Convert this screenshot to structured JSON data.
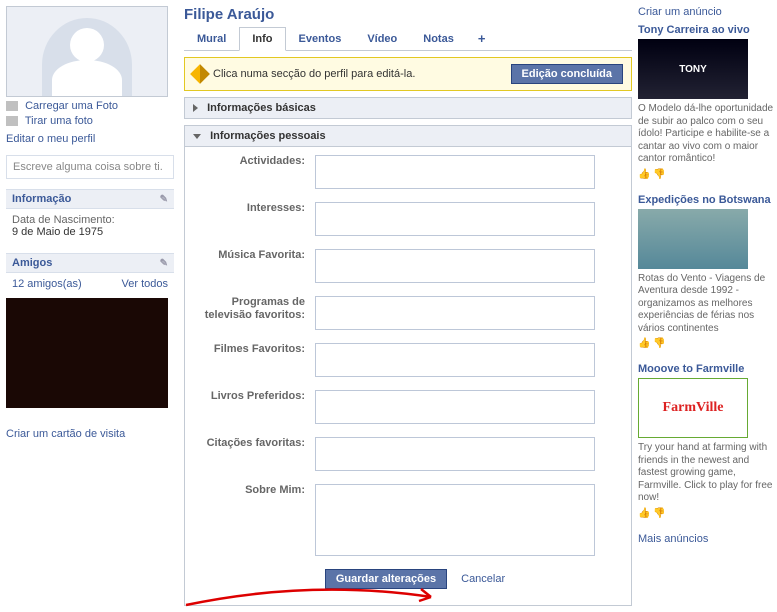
{
  "profile": {
    "name": "Filipe Araújo",
    "upload_photo": "Carregar uma Foto",
    "take_photo": "Tirar uma foto",
    "edit_profile": "Editar o meu perfil",
    "status_placeholder": "Escreve alguma coisa sobre ti."
  },
  "sidebar": {
    "info": {
      "title": "Informação",
      "dob_label": "Data de Nascimento:",
      "dob_value": "9 de Maio de 1975"
    },
    "friends": {
      "title": "Amigos",
      "count": "12 amigos(as)",
      "see_all": "Ver todos"
    },
    "biz_card": "Criar um cartão de visita"
  },
  "tabs": {
    "wall": "Mural",
    "info": "Info",
    "events": "Eventos",
    "video": "Vídeo",
    "notes": "Notas",
    "plus": "+"
  },
  "notice": {
    "text": "Clica numa secção do perfil para editá-la.",
    "done_btn": "Edição concluída"
  },
  "sections": {
    "basic": "Informações básicas",
    "personal": "Informações pessoais"
  },
  "form": {
    "activities": "Actividades:",
    "interests": "Interesses:",
    "music": "Música Favorita:",
    "tv": "Programas de televisão favoritos:",
    "movies": "Filmes Favoritos:",
    "books": "Livros Preferidos:",
    "quotes": "Citações favoritas:",
    "about": "Sobre Mim:",
    "save": "Guardar alterações",
    "cancel": "Cancelar"
  },
  "ads": {
    "create": "Criar um anúncio",
    "more": "Mais anúncios",
    "items": [
      {
        "title": "Tony Carreira ao vivo",
        "img_text": "TONY",
        "text": "O Modelo dá-lhe oportunidade de subir ao palco com o seu ídolo! Participe e habilite-se a cantar ao vivo com o maior cantor romântico!"
      },
      {
        "title": "Expedições no Botswana",
        "img_text": "",
        "text": "Rotas do Vento - Viagens de Aventura desde 1992 - organizamos as melhores experiências de férias nos vários continentes"
      },
      {
        "title": "Mooove to Farmville",
        "img_text": "FarmVille",
        "text": "Try your hand at farming with friends in the newest and fastest growing game, Farmville. Click to play for free now!"
      }
    ]
  }
}
